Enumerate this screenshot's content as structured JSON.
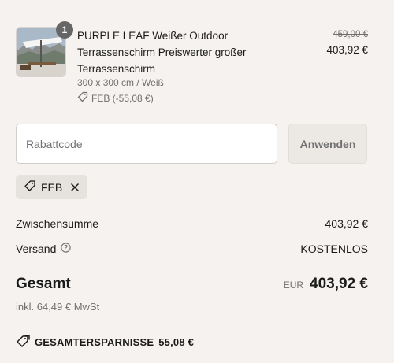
{
  "product": {
    "quantity": "1",
    "title": "PURPLE LEAF Weißer Outdoor Terrassenschirm Preiswerter großer Terrassenschirm",
    "variant": "300 x 300 cm / Weiß",
    "discount": "FEB (-55,08 €)",
    "old_price": "459,00 €",
    "price": "403,92 €"
  },
  "discount_code": {
    "placeholder": "Rabattcode",
    "apply_label": "Anwenden",
    "applied_code": "FEB"
  },
  "totals": {
    "subtotal_label": "Zwischensumme",
    "subtotal_value": "403,92 €",
    "shipping_label": "Versand",
    "shipping_value": "KOSTENLOS",
    "total_label": "Gesamt",
    "currency": "EUR",
    "total_value": "403,92 €",
    "tax_note": "inkl. 64,49 € MwSt",
    "savings_label": "GESAMTERSPARNISSE",
    "savings_value": "55,08 €"
  }
}
